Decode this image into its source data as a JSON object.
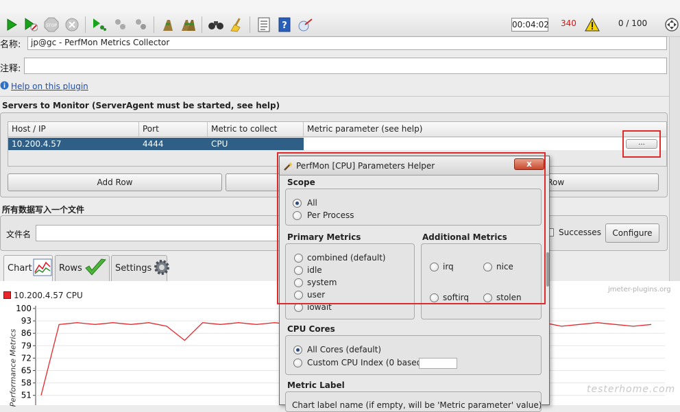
{
  "toolbar": {
    "timer": "00:04:02",
    "count": "340",
    "threads": "0 / 100",
    "icons": [
      "start-icon",
      "start-no-pause-icon",
      "stop-icon",
      "shutdown-icon",
      "remote-start-icon",
      "remote-stop-icon",
      "remote-shutdown-icon",
      "clear-icon",
      "clear-all-icon",
      "search-icon",
      "reset-search-icon",
      "function-helper-icon",
      "help-icon",
      "ssl-manager-icon",
      "warning-icon",
      "expand-icon"
    ]
  },
  "form": {
    "name_label": "名称:",
    "name_value": "jp@gc - PerfMon Metrics Collector",
    "comment_label": "注释:",
    "comment_value": "",
    "help_link": "Help on this plugin"
  },
  "servers": {
    "section_title": "Servers to Monitor (ServerAgent must be started, see help)",
    "columns": [
      "Host / IP",
      "Port",
      "Metric to collect",
      "Metric parameter (see help)"
    ],
    "rows": [
      [
        "10.200.4.57",
        "4444",
        "CPU",
        ""
      ]
    ],
    "ellipsis_button": "...",
    "add_row": "Add Row",
    "delete_row_partial": "e Row"
  },
  "file": {
    "section_title": "所有数据写入一个文件",
    "filename_label": "文件名",
    "successes_label": "Successes",
    "configure": "Configure"
  },
  "tabs": [
    {
      "label": "Chart",
      "icon": "chart-icon"
    },
    {
      "label": "Rows",
      "icon": "checkmark-icon"
    },
    {
      "label": "Settings",
      "icon": "gear-icon"
    }
  ],
  "chart": {
    "legend": "10.200.4.57 CPU",
    "ylabel": "Performance Metrics",
    "watermark": "jmeter-plugins.org",
    "site_watermark": "testerhome.com",
    "yticks": [
      "100",
      "93",
      "86",
      "79",
      "72",
      "65",
      "58",
      "51"
    ],
    "series_color": "#e8262a"
  },
  "chart_data": {
    "type": "line",
    "ylabel": "Performance Metrics",
    "ylim": [
      51,
      100
    ],
    "series": [
      {
        "name": "10.200.4.57 CPU",
        "values": [
          51,
          91,
          92,
          91,
          92,
          91,
          92,
          90,
          82,
          92,
          91,
          92,
          91,
          92,
          91,
          92,
          90,
          91,
          80,
          77,
          85,
          88,
          91,
          92,
          91,
          90,
          92,
          91,
          92,
          90,
          91,
          92,
          91,
          90,
          91
        ]
      }
    ]
  },
  "dialog": {
    "title": "PerfMon [CPU] Parameters Helper",
    "close": "x",
    "scope": {
      "title": "Scope",
      "options": [
        "All",
        "Per Process"
      ],
      "selected": 0
    },
    "primary": {
      "title": "Primary Metrics",
      "options": [
        "combined (default)",
        "idle",
        "system",
        "user",
        "iowait"
      ]
    },
    "additional": {
      "title": "Additional Metrics",
      "options": [
        "irq",
        "nice",
        "softirq",
        "stolen"
      ]
    },
    "cores": {
      "title": "CPU Cores",
      "options": [
        "All Cores (default)",
        "Custom CPU Index (0 based)"
      ],
      "selected": 0,
      "index_value": ""
    },
    "label_section": {
      "title": "Metric Label",
      "hint": "Chart label name (if empty, will be 'Metric parameter' value):"
    }
  }
}
